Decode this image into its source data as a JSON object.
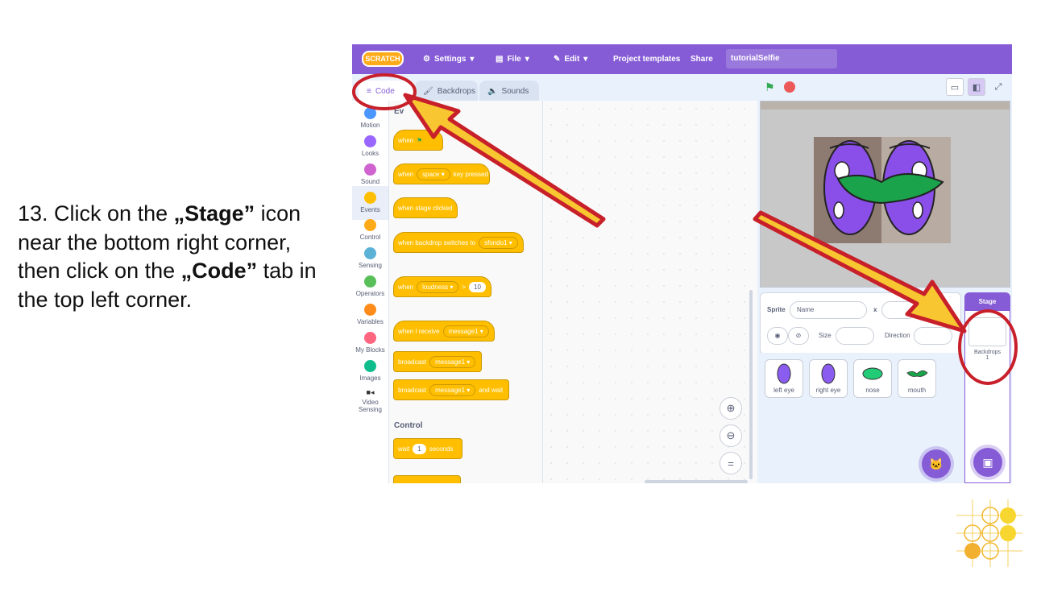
{
  "instruction": {
    "number": "13.",
    "part1": " Click on the ",
    "stage_word": "„Stage”",
    "part2": " icon near the bottom right corner, then click on the ",
    "code_word": "„Code”",
    "part3": " tab in the top left corner."
  },
  "menubar": {
    "logo": "SCRATCH",
    "settings": "Settings",
    "file": "File",
    "edit": "Edit",
    "project_templates": "Project templates",
    "share": "Share",
    "project_title": "tutorialSelfie"
  },
  "tabs": {
    "code": "Code",
    "backdrops": "Backdrops",
    "sounds": "Sounds"
  },
  "categories": [
    {
      "label": "Motion",
      "color": "#4c97ff"
    },
    {
      "label": "Looks",
      "color": "#9966ff"
    },
    {
      "label": "Sound",
      "color": "#cf63cf"
    },
    {
      "label": "Events",
      "color": "#ffbf00"
    },
    {
      "label": "Control",
      "color": "#ffab19"
    },
    {
      "label": "Sensing",
      "color": "#5cb1d6"
    },
    {
      "label": "Operators",
      "color": "#59c059"
    },
    {
      "label": "Variables",
      "color": "#ff8c1a"
    },
    {
      "label": "My Blocks",
      "color": "#ff6680"
    },
    {
      "label": "Images",
      "color": "#0fbd8c"
    },
    {
      "label": "Video Sensing",
      "color": "#0fbd8c"
    }
  ],
  "palette": {
    "events_title_partial": "Ev",
    "when_flag": "when",
    "when_key": "when",
    "key_value": "space",
    "key_pressed": "key pressed",
    "stage_clicked": "when stage clicked",
    "backdrop_switches": "when backdrop switches to",
    "backdrop_value": "sfondo1",
    "when_loudness": "when",
    "loudness_option": "loudness",
    "greater": ">",
    "loudness_value": "10",
    "when_receive": "when I receive",
    "message1": "message1",
    "broadcast": "broadcast",
    "broadcast_message": "message1",
    "broadcast_wait": "broadcast",
    "broadcast_wait_message": "message1",
    "and_wait": "and wait",
    "control_title": "Control",
    "wait": "wait",
    "wait_value": "1",
    "seconds": "seconds"
  },
  "sprite_info": {
    "sprite_label": "Sprite",
    "name_placeholder": "Name",
    "x_label": "x",
    "size_label": "Size",
    "direction_label": "Direction"
  },
  "sprites": [
    {
      "name": "left eye",
      "color": "#8a5cf0"
    },
    {
      "name": "right eye",
      "color": "#8a5cf0"
    },
    {
      "name": "nose",
      "color": "#22cc77"
    },
    {
      "name": "mouth",
      "color": "#1aa34a"
    }
  ],
  "stage_panel": {
    "header": "Stage",
    "backdrops_label": "Backdrops",
    "backdrops_count": "1"
  },
  "colors": {
    "scratch_purple": "#855cd6",
    "annotation_red": "#c8202a",
    "arrow_yellow": "#f8c630"
  }
}
